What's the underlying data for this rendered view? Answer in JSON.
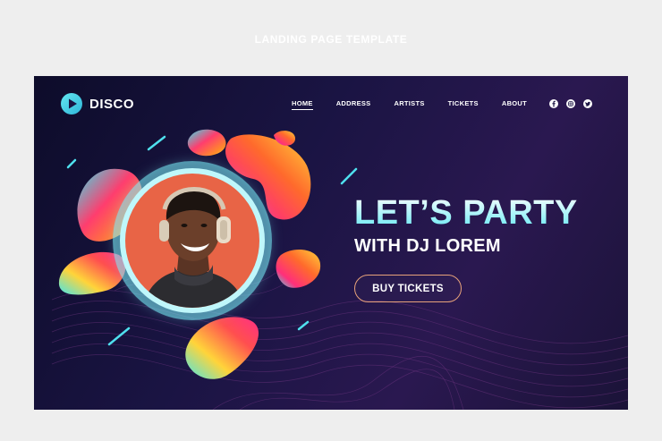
{
  "page_label": "LANDING PAGE TEMPLATE",
  "brand": {
    "name": "DISCO",
    "icon": "play-icon"
  },
  "nav": [
    {
      "label": "HOME",
      "active": true
    },
    {
      "label": "ADDRESS"
    },
    {
      "label": "ARTISTS"
    },
    {
      "label": "TICKETS"
    },
    {
      "label": "ABOUT"
    }
  ],
  "social": [
    "facebook-icon",
    "instagram-icon",
    "twitter-icon"
  ],
  "hero": {
    "title": "LET’S PARTY",
    "subtitle": "WITH DJ LOREM",
    "cta": "BUY TICKETS"
  },
  "colors": {
    "background": "#1a1443",
    "accent_cyan": "#63e7f0",
    "portrait_bg": "#e86446",
    "cta_border": "#e7a27a"
  }
}
